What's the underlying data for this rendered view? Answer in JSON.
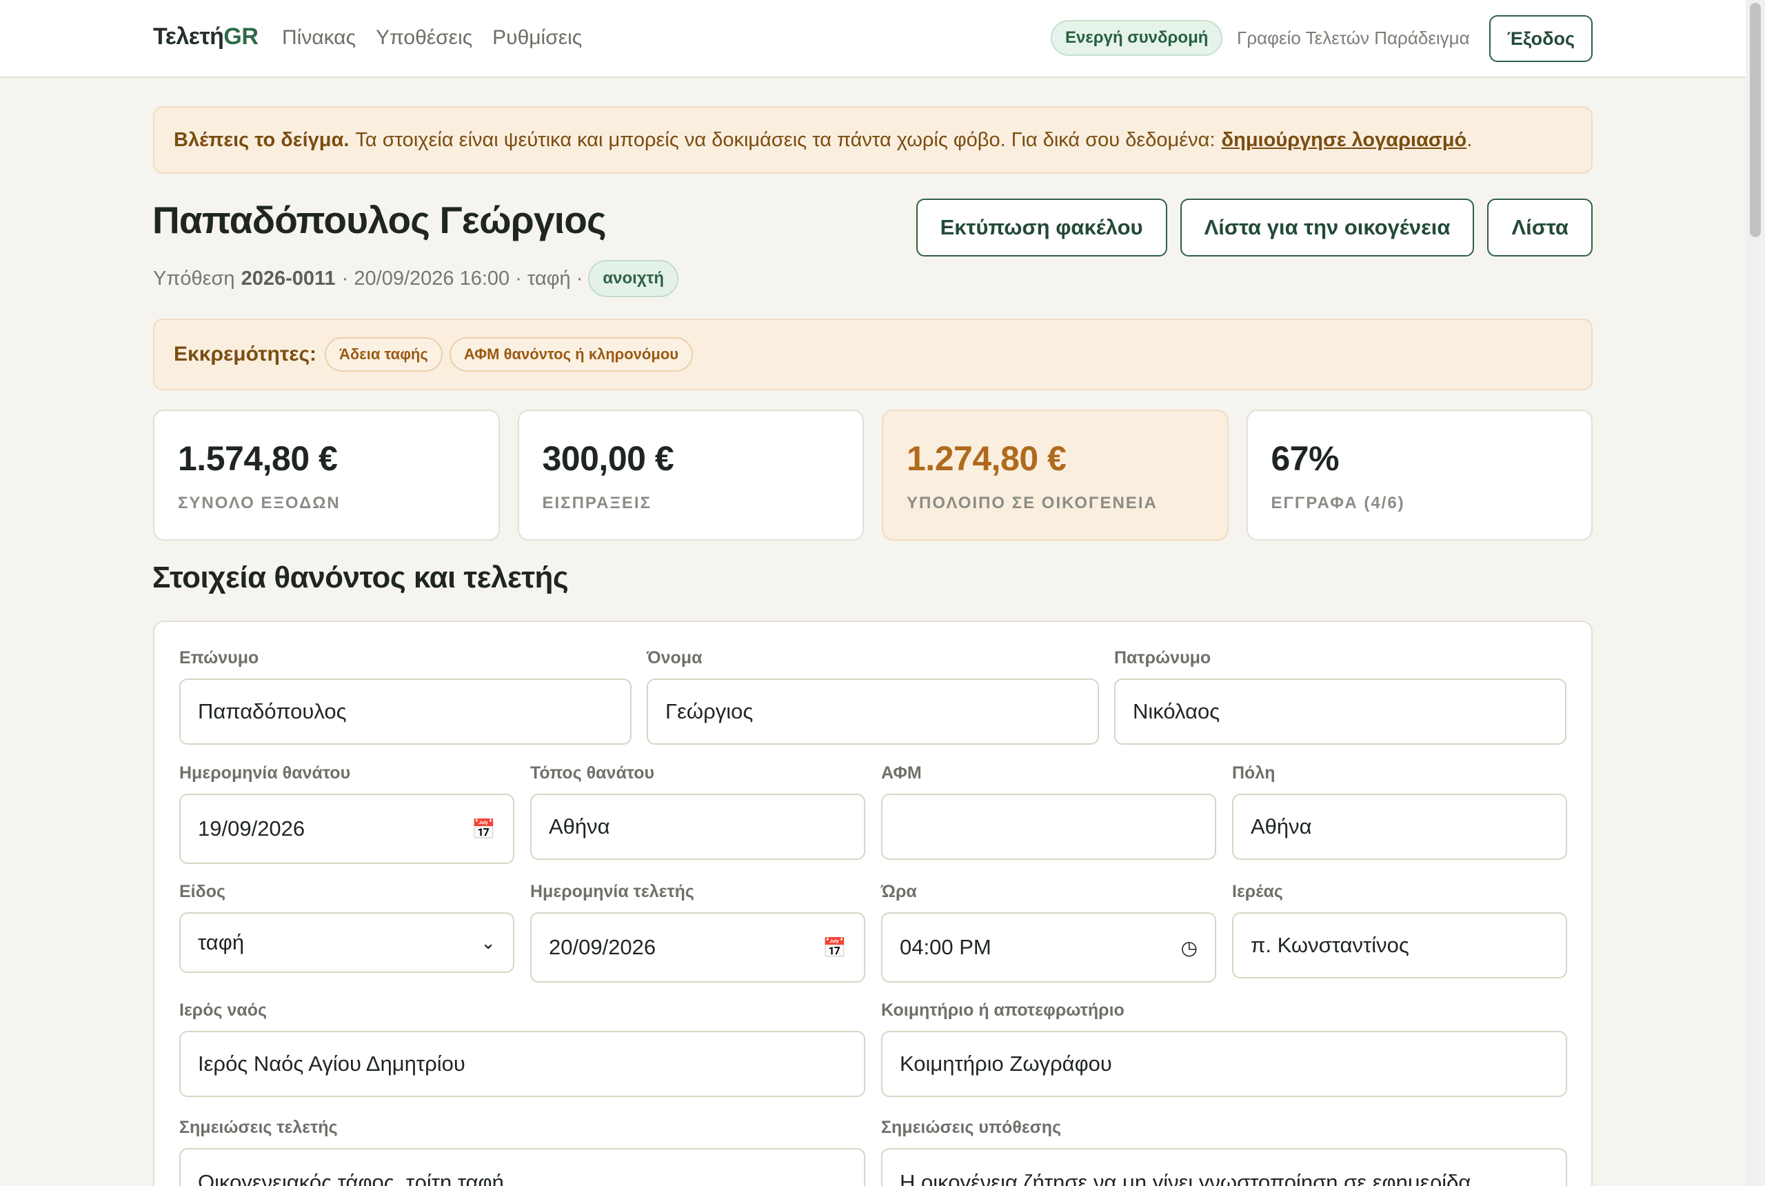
{
  "nav": {
    "brand_main": "Τελετή",
    "brand_accent": "GR",
    "links": [
      "Πίνακας",
      "Υποθέσεις",
      "Ρυθμίσεις"
    ],
    "subscription_badge": "Ενεργή συνδρομή",
    "office_name": "Γραφείο Τελετών Παράδειγμα",
    "logout": "Έξοδος"
  },
  "demo_banner": {
    "lead": "Βλέπεις το δείγμα.",
    "text": "Τα στοιχεία είναι ψεύτικα και μπορείς να δοκιμάσεις τα πάντα χωρίς φόβο. Για δικά σου δεδομένα:",
    "link": "δημιούργησε λογαριασμό",
    "tail": "."
  },
  "case": {
    "title": "Παπαδόπουλος Γεώργιος",
    "meta_prefix": "Υπόθεση",
    "code": "2026-0011",
    "meta_rest": "· 20/09/2026 16:00 · ταφή ·",
    "status": "ανοιχτή",
    "actions": [
      "Εκτύπωση φακέλου",
      "Λίστα για την οικογένεια",
      "Λίστα"
    ]
  },
  "pending": {
    "label": "Εκκρεμότητες:",
    "items": [
      "Άδεια ταφής",
      "ΑΦΜ θανόντος ή κληρονόμου"
    ]
  },
  "stats": [
    {
      "value": "1.574,80 €",
      "label": "ΣΥΝΟΛΟ ΕΞΟΔΩΝ"
    },
    {
      "value": "300,00 €",
      "label": "ΕΙΣΠΡΑΞΕΙΣ"
    },
    {
      "value": "1.274,80 €",
      "label": "ΥΠΟΛΟΙΠΟ ΣΕ ΟΙΚΟΓΕΝΕΙΑ"
    },
    {
      "value": "67%",
      "label": "ΕΓΓΡΑΦΑ (4/6)"
    }
  ],
  "section": {
    "title": "Στοιχεία θανόντος και τελετής"
  },
  "form": {
    "surname": {
      "label": "Επώνυμο",
      "value": "Παπαδόπουλος"
    },
    "first_name": {
      "label": "Όνομα",
      "value": "Γεώργιος"
    },
    "father_name": {
      "label": "Πατρώνυμο",
      "value": "Νικόλαος"
    },
    "death_date": {
      "label": "Ημερομηνία θανάτου",
      "value": "19/09/2026"
    },
    "death_place": {
      "label": "Τόπος θανάτου",
      "value": "Αθήνα"
    },
    "afm": {
      "label": "ΑΦΜ",
      "value": ""
    },
    "city": {
      "label": "Πόλη",
      "value": "Αθήνα"
    },
    "type": {
      "label": "Είδος",
      "value": "ταφή"
    },
    "ceremony_date": {
      "label": "Ημερομηνία τελετής",
      "value": "20/09/2026"
    },
    "time": {
      "label": "Ώρα",
      "value": "04:00 PM"
    },
    "priest": {
      "label": "Ιερέας",
      "value": "π. Κωνσταντίνος"
    },
    "church": {
      "label": "Ιερός ναός",
      "value": "Ιερός Ναός Αγίου Δημητρίου"
    },
    "cemetery": {
      "label": "Κοιμητήριο ή αποτεφρωτήριο",
      "value": "Κοιμητήριο Ζωγράφου"
    },
    "ceremony_notes": {
      "label": "Σημειώσεις τελετής",
      "value": "Οικογενειακός τάφος, τρίτη ταφή."
    },
    "case_notes": {
      "label": "Σημειώσεις υπόθεσης",
      "value": "Η οικογένεια ζήτησε να μη γίνει γνωστοποίηση σε εφημερίδα."
    }
  },
  "icons": {
    "calendar": "calendar-icon",
    "clock": "clock-icon",
    "chevron": "chevron-down-icon"
  },
  "colors": {
    "brand_green": "#2f6b4a",
    "warning_bg": "#faeedf",
    "warning_text": "#7a4d10",
    "balance_orange": "#b06a1c"
  }
}
